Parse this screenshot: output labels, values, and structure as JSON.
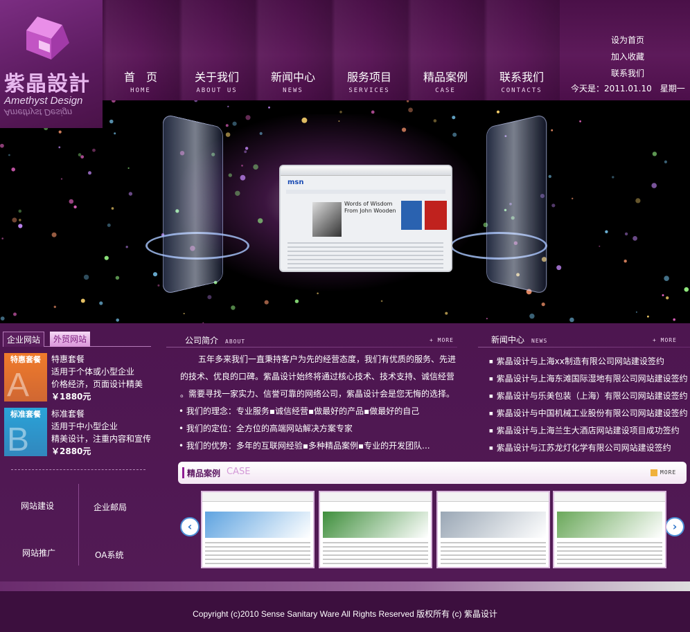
{
  "brand": {
    "name_cn": "紫晶設計",
    "name_en": "Amethyst Design"
  },
  "nav": [
    {
      "cn": "首　页",
      "en": "HOME"
    },
    {
      "cn": "关于我们",
      "en": "ABOUT US"
    },
    {
      "cn": "新闻中心",
      "en": "NEWS"
    },
    {
      "cn": "服务项目",
      "en": "SERVICES"
    },
    {
      "cn": "精品案例",
      "en": "CASE"
    },
    {
      "cn": "联系我们",
      "en": "CONTACTS"
    }
  ],
  "utility": {
    "set_home": "设为首页",
    "favorite": "加入收藏",
    "contact": "联系我们",
    "date": "今天是：2011.01.10　星期一"
  },
  "banner": {
    "browser_logo": "msn",
    "headline": "Words of Wisdom From John Wooden"
  },
  "left": {
    "tabs": [
      "企业网站",
      "外贸网站"
    ],
    "packages": [
      {
        "badge": "特惠套餐",
        "letter": "A",
        "title": "特惠套餐",
        "line1": "适用于个体或小型企业",
        "line2": "价格经济，页面设计精美",
        "price": "￥1880元",
        "color": "#f07b2b"
      },
      {
        "badge": "标准套餐",
        "letter": "B",
        "title": "标准套餐",
        "line1": "适用于中小型企业",
        "line2": "精美设计，注重内容和宣传",
        "price": "￥2880元",
        "color": "#2aa3d8"
      }
    ],
    "services": [
      "网站建设",
      "企业邮局",
      "网站推广",
      "OA系统"
    ]
  },
  "about": {
    "title": "公司简介",
    "title_en": "ABOUT",
    "more": "+ MORE",
    "paragraph_lines": [
      "五年多来我们一直秉持客户为先的经营态度，我们有优质的服务、先进",
      "的技术、优良的口碑。紫晶设计始终将通过核心技术、技术支持、诚信经营",
      "。需要寻找一家实力、信誉可靠的网络公司，紫晶设计会是您无悔的选择。"
    ],
    "points": [
      "我们的理念：专业服务▪诚信经营▪做最好的产品▪做最好的自己",
      "我们的定位：全方位的高端网站解决方案专家",
      "我们的优势：多年的互联网经验▪多种精品案例▪专业的开发团队..."
    ]
  },
  "news": {
    "title": "新闻中心",
    "title_en": "NEWS",
    "more": "+ MORE",
    "items": [
      "紫晶设计与上海xx制造有限公司网站建设签约",
      "紫晶设计与上海东滩国际湿地有限公司网站建设签约",
      "紫晶设计与乐美包装（上海）有限公司网站建设签约",
      "紫晶设计与中国机械工业股份有限公司网站建设签约",
      "紫晶设计与上海兰生大酒店网站建设项目成功签约",
      "紫晶设计与江苏龙灯化学有限公司网站建设签约"
    ]
  },
  "cases": {
    "title": "精品案例",
    "title_en": "CASE",
    "more": "MORE",
    "prev": "‹",
    "next": "›",
    "thumbs": [
      {
        "hero": "#5ea3e0"
      },
      {
        "hero": "#3f8f3c"
      },
      {
        "hero": "#9aa7b5"
      },
      {
        "hero": "#6aa85a"
      }
    ]
  },
  "footer": {
    "copyright": "Copyright (c)2010  Sense  Sanitary Ware All Rights Reserved    版权所有 (c)  紫晶设计"
  }
}
